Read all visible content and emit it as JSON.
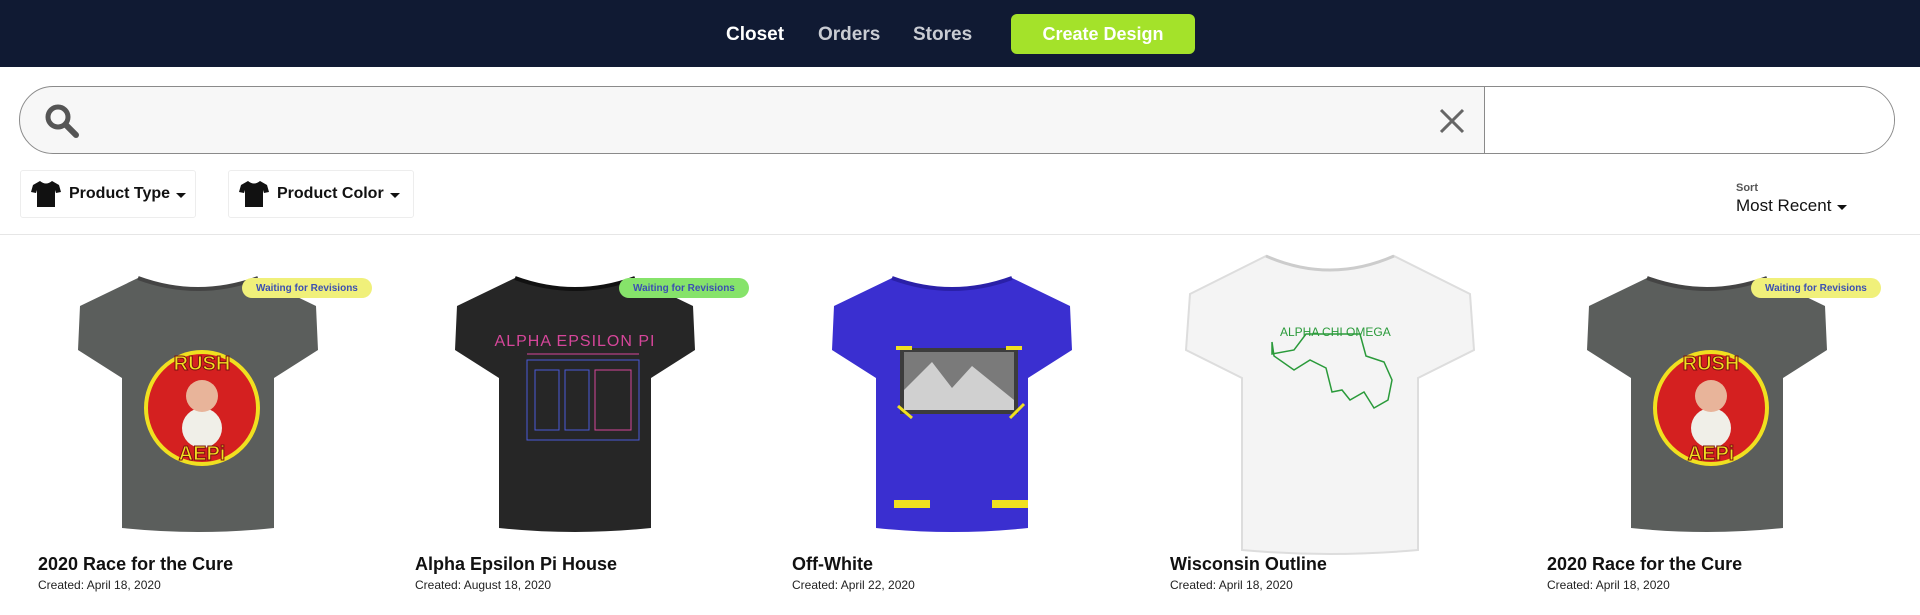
{
  "nav": {
    "links": [
      {
        "label": "Closet",
        "active": true
      },
      {
        "label": "Orders",
        "active": false
      },
      {
        "label": "Stores",
        "active": false
      }
    ],
    "create_label": "Create Design",
    "accent": "#a4e22a",
    "background": "#101a33"
  },
  "search": {
    "value": "",
    "placeholder": ""
  },
  "filters": {
    "product_type": "Product Type",
    "product_color": "Product Color"
  },
  "sort": {
    "caption": "Sort",
    "value": "Most Recent"
  },
  "designs": [
    {
      "title": "2020 Race for the Cure",
      "created": "Created: April 18, 2020",
      "badge": "Waiting for Revisions",
      "badge_color": "#f0f07a",
      "shirt_color": "#5b5e5c",
      "graphic": "popeye-rush-aepi"
    },
    {
      "title": "Alpha Epsilon Pi House",
      "created": "Created: August 18, 2020",
      "badge": "Waiting for Revisions",
      "badge_color": "#86e36a",
      "shirt_color": "#262626",
      "graphic": "alpha-epsilon-pi-house"
    },
    {
      "title": "Off-White",
      "created": "Created: April 22, 2020",
      "badge": "",
      "badge_color": "",
      "shirt_color": "#3a2fd0",
      "graphic": "off-white-photo"
    },
    {
      "title": "Wisconsin Outline",
      "created": "Created: April 18, 2020",
      "badge": "",
      "badge_color": "",
      "shirt_color": "#f4f4f4",
      "graphic": "alpha-chi-omega-outline"
    },
    {
      "title": "2020 Race for the Cure",
      "created": "Created: April 18, 2020",
      "badge": "Waiting for Revisions",
      "badge_color": "#f0f07a",
      "shirt_color": "#5b5e5c",
      "graphic": "popeye-rush-aepi"
    }
  ],
  "shirt_graphic_text": {
    "rush": "RUSH",
    "aepi": "AEPi",
    "alpha_epsilon_pi": "ALPHA EPSILON PI",
    "alpha_chi_omega": "ALPHA CHI OMEGA"
  }
}
